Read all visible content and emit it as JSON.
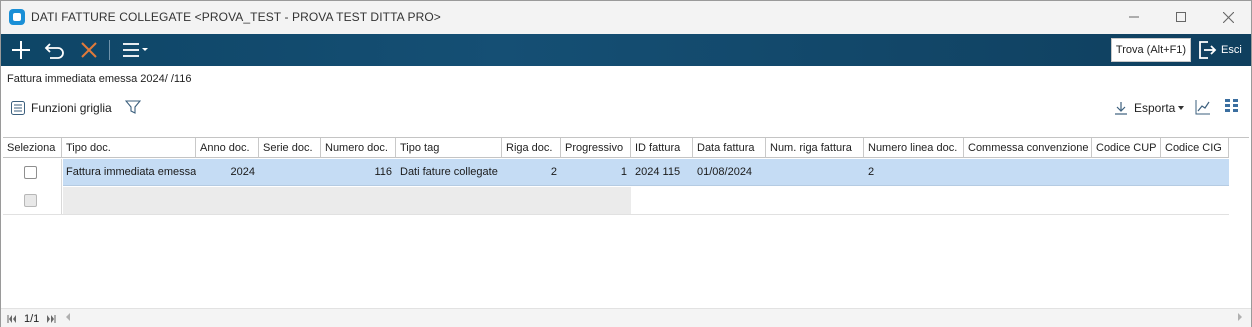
{
  "window": {
    "title": "DATI FATTURE COLLEGATE <PROVA_TEST - PROVA TEST DITTA PRO>"
  },
  "toolbar": {
    "icons": [
      "plus-icon",
      "undo-icon",
      "delete-icon",
      "menu-icon"
    ],
    "find_label": "Trova (Alt+F1)",
    "exit_label": "Esci"
  },
  "document": {
    "title": "Fattura immediata emessa 2024/ /116"
  },
  "grid_actions": {
    "functions_label": "Funzioni griglia",
    "export_label": "Esporta"
  },
  "grid": {
    "columns": [
      "Seleziona",
      "Tipo doc.",
      "Anno doc.",
      "Serie doc.",
      "Numero doc.",
      "Tipo tag",
      "Riga doc.",
      "Progressivo",
      "ID fattura",
      "Data fattura",
      "Num. riga fattura",
      "Numero linea doc.",
      "Commessa convenzione",
      "Codice CUP",
      "Codice CIG"
    ],
    "rows": [
      {
        "tipo_doc": "Fattura immediata emessa",
        "anno_doc": "2024",
        "serie_doc": "",
        "numero_doc": "116",
        "tipo_tag": "Dati fature collegate",
        "riga_doc": "2",
        "progressivo": "1",
        "id_fattura": "2024 115",
        "data_fattura": "01/08/2024",
        "num_riga_fattura": "",
        "numero_linea_doc": "2",
        "commessa_convenzione": "",
        "codice_cup": "",
        "codice_cig": ""
      }
    ]
  },
  "footer": {
    "page_label": "1/1"
  },
  "colors": {
    "toolbar_bg": "#154f74",
    "selected_row": "#c5dcf4",
    "delete_icon": "#e07a3a"
  }
}
